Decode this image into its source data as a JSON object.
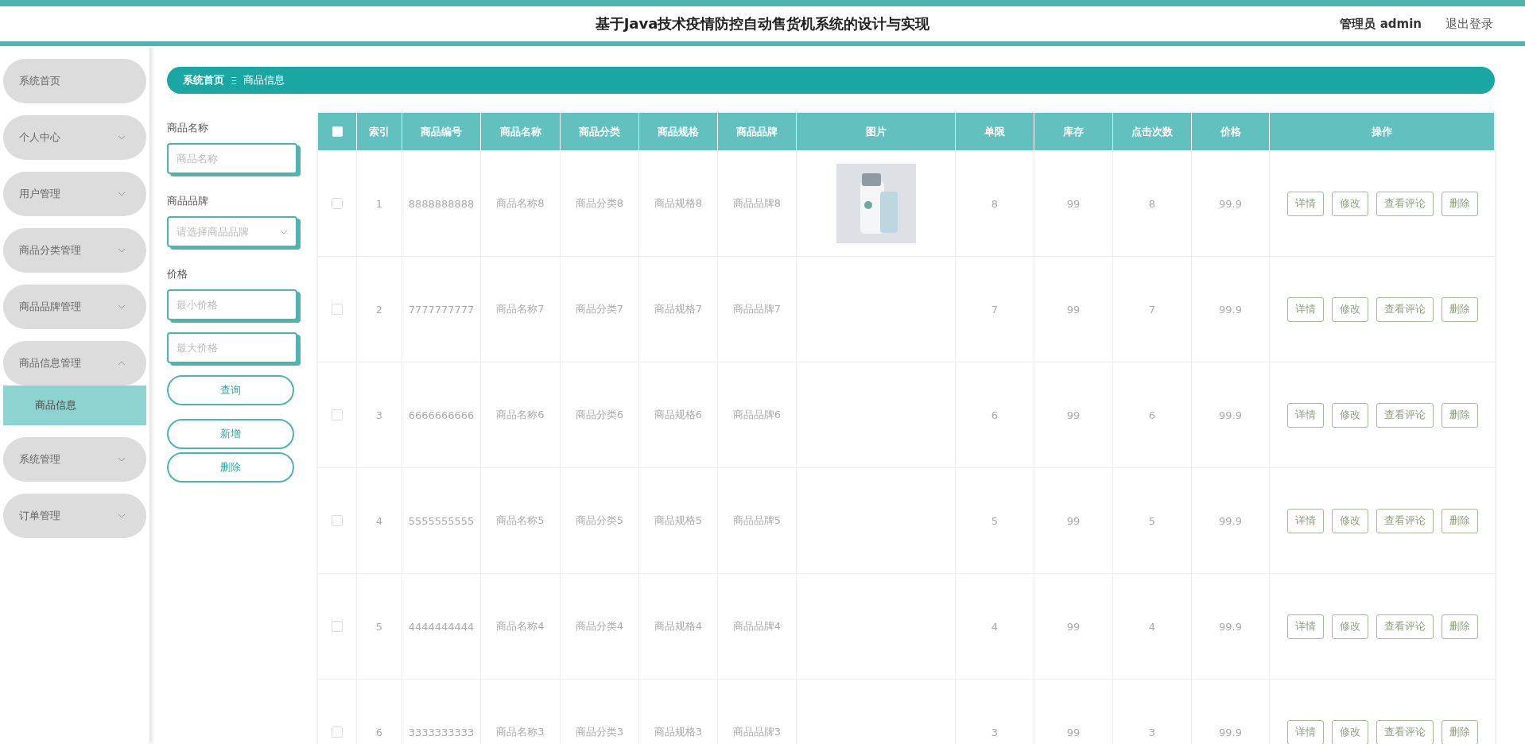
{
  "header": {
    "title": "基于Java技术疫情防控自动售货机系统的设计与实现",
    "user": "管理员 admin",
    "logout": "退出登录"
  },
  "sidebar": {
    "items": [
      {
        "kind": "link",
        "label": "系统首页"
      },
      {
        "kind": "menu",
        "label": "个人中心",
        "expanded": false
      },
      {
        "kind": "menu",
        "label": "用户管理",
        "expanded": false
      },
      {
        "kind": "menu",
        "label": "商品分类管理",
        "expanded": false
      },
      {
        "kind": "menu",
        "label": "商品品牌管理",
        "expanded": false
      },
      {
        "kind": "menu",
        "label": "商品信息管理",
        "expanded": true,
        "children": [
          {
            "label": "商品信息",
            "selected": true
          }
        ]
      },
      {
        "kind": "menu",
        "label": "系统管理",
        "expanded": false
      },
      {
        "kind": "menu",
        "label": "订单管理",
        "expanded": false
      }
    ]
  },
  "breadcrumb": {
    "items": [
      "系统首页",
      "商品信息"
    ],
    "separator": "Ξ"
  },
  "filters": {
    "name_label": "商品名称",
    "name_placeholder": "商品名称",
    "brand_label": "商品品牌",
    "brand_placeholder": "请选择商品品牌",
    "price_label": "价格",
    "min_placeholder": "最小价格",
    "max_placeholder": "最大价格",
    "buttons": [
      "查询",
      "新增",
      "删除"
    ]
  },
  "table": {
    "header_checked": false,
    "columns": [
      "索引",
      "商品编号",
      "商品名称",
      "商品分类",
      "商品规格",
      "商品品牌",
      "图片",
      "单限",
      "库存",
      "点击次数",
      "价格",
      "操作"
    ],
    "rows": [
      {
        "checked": false,
        "cells": [
          "1",
          "8888888888",
          "商品名称8",
          "商品分类8",
          "商品规格8",
          "商品品牌8"
        ],
        "has_image": true,
        "tail": [
          "8",
          "99",
          "8",
          "99.9"
        ],
        "actions": [
          "详情",
          "修改",
          "查看评论",
          "删除"
        ]
      },
      {
        "checked": false,
        "cells": [
          "2",
          "7777777777",
          "商品名称7",
          "商品分类7",
          "商品规格7",
          "商品品牌7"
        ],
        "has_image": false,
        "tail": [
          "7",
          "99",
          "7",
          "99.9"
        ],
        "actions": [
          "详情",
          "修改",
          "查看评论",
          "删除"
        ]
      },
      {
        "checked": false,
        "cells": [
          "3",
          "6666666666",
          "商品名称6",
          "商品分类6",
          "商品规格6",
          "商品品牌6"
        ],
        "has_image": false,
        "tail": [
          "6",
          "99",
          "6",
          "99.9"
        ],
        "actions": [
          "详情",
          "修改",
          "查看评论",
          "删除"
        ]
      },
      {
        "checked": false,
        "cells": [
          "4",
          "5555555555",
          "商品名称5",
          "商品分类5",
          "商品规格5",
          "商品品牌5"
        ],
        "has_image": false,
        "tail": [
          "5",
          "99",
          "5",
          "99.9"
        ],
        "actions": [
          "详情",
          "修改",
          "查看评论",
          "删除"
        ]
      },
      {
        "checked": false,
        "cells": [
          "5",
          "4444444444",
          "商品名称4",
          "商品分类4",
          "商品规格4",
          "商品品牌4"
        ],
        "has_image": false,
        "tail": [
          "4",
          "99",
          "4",
          "99.9"
        ],
        "actions": [
          "详情",
          "修改",
          "查看评论",
          "删除"
        ]
      },
      {
        "checked": false,
        "cells": [
          "6",
          "3333333333",
          "商品名称3",
          "商品分类3",
          "商品规格3",
          "商品品牌3"
        ],
        "has_image": false,
        "tail": [
          "3",
          "99",
          "3",
          "99.9"
        ],
        "actions": [
          "详情",
          "修改",
          "查看评论",
          "删除"
        ]
      }
    ]
  }
}
